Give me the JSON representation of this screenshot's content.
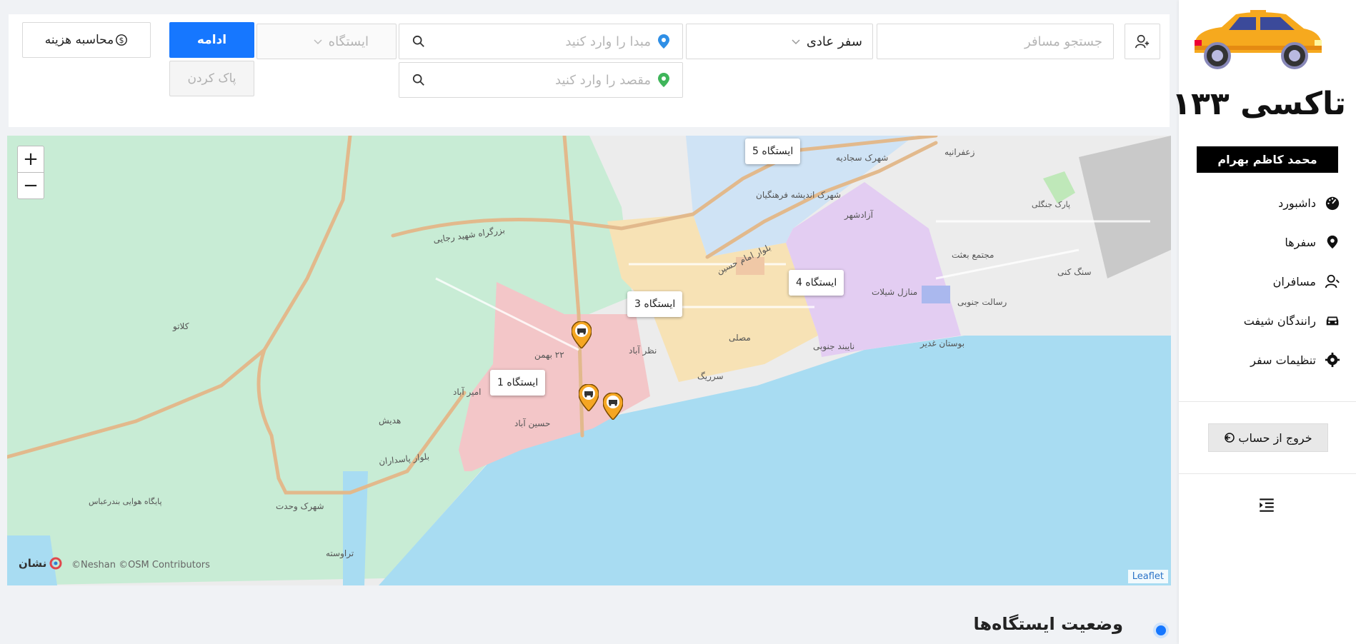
{
  "sidebar": {
    "brand": "تاکسی ۱۳۳",
    "user_name": "محمد کاظم بهرام",
    "nav": [
      {
        "label": "داشبورد",
        "icon": "dashboard-icon"
      },
      {
        "label": "سفرها",
        "icon": "location-pin-icon"
      },
      {
        "label": "مسافران",
        "icon": "user-icon"
      },
      {
        "label": "رانندگان شیفت",
        "icon": "car-icon"
      },
      {
        "label": "تنظیمات سفر",
        "icon": "gear-icon"
      }
    ],
    "logout_label": "خروج از حساب"
  },
  "toolbar": {
    "passenger_search_placeholder": "جستجو مسافر",
    "trip_type_value": "سفر عادی",
    "origin_placeholder": "مبدا را وارد کنید",
    "destination_placeholder": "مقصد را وارد کنید",
    "station_placeholder": "ایستگاه",
    "continue_label": "ادامه",
    "clear_label": "پاک کردن",
    "calc_cost_label": "محاسبه هزینه"
  },
  "colors": {
    "primary": "#1677ff",
    "zone_green": "#c8ecd5",
    "zone_red": "#f3c6c8",
    "zone_orange": "#f7e2b5",
    "zone_blue": "#cfe3f5",
    "zone_purple": "#e3cdf2",
    "sea": "#a8dcf2"
  },
  "map": {
    "zoom_in": "+",
    "zoom_out": "−",
    "stations": [
      "ایستگاه 1",
      "ایستگاه 3",
      "ایستگاه 4",
      "ایستگاه 5"
    ],
    "place_labels": [
      "بزرگراه شهید رجایی",
      "شهرک سجادیه",
      "زعفرانیه",
      "شهرک اندیشه فرهنگیان",
      "آزادشهر",
      "بلوار امام حسین",
      "منازل شیلات",
      "مجتمع بعثت",
      "سنگ کنی",
      "رسالت جنوبی",
      "کلاتو",
      "مصلی",
      "نظر آباد",
      "سرریگ",
      "نایبند جنوبی",
      "بوستان غدیر",
      "۲۲ بهمن",
      "امیر آباد",
      "هدیش",
      "حسین آباد",
      "بلوار پاسداران",
      "شهرک وحدت",
      "تراوسته",
      "پایگاه هوایی بندرعباس",
      "پارک جنگلی"
    ],
    "attribution_brand": "نشان",
    "attribution_text": "©Neshan ©OSM Contributors",
    "leaflet": "Leaflet"
  },
  "section": {
    "station_status_title": "وضعیت ایستگاه‌ها"
  }
}
